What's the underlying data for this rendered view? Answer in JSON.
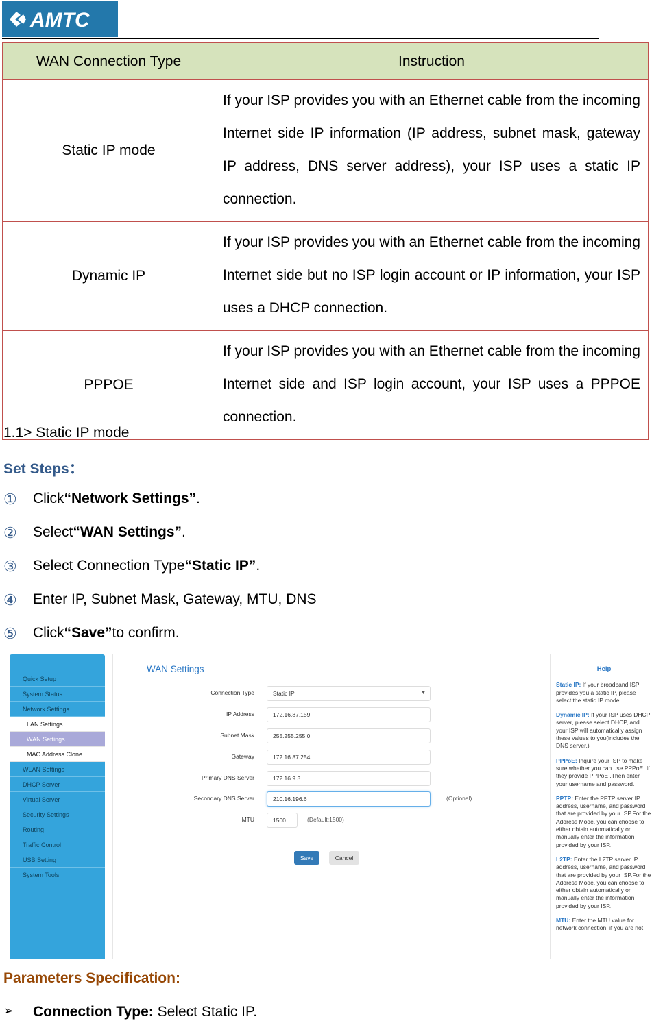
{
  "brand": {
    "logo_text": "AMTC",
    "logo_color": "#2378ab"
  },
  "table": {
    "headers": [
      "WAN Connection Type",
      "Instruction"
    ],
    "rows": [
      {
        "type": "Static IP mode",
        "instruction": "If your ISP provides you with an Ethernet cable from the incoming Internet side IP information (IP address, subnet mask, gateway IP address, DNS server address), your ISP uses a static IP connection."
      },
      {
        "type": "Dynamic IP",
        "instruction": "If your ISP provides you with an Ethernet cable from the incoming Internet side but no ISP login account or IP information, your ISP uses a DHCP connection."
      },
      {
        "type": "PPPOE",
        "instruction": "If your ISP provides you with an Ethernet cable from the incoming Internet side and ISP login account, your ISP uses a PPPOE connection."
      }
    ],
    "header_bg": "#d6e3bc",
    "border_color": "#c0504d"
  },
  "section": {
    "title": "1.1> Static IP mode",
    "set_steps_label": "Set Steps：",
    "steps": [
      {
        "num": "①",
        "pre": "Click ",
        "bold": "“Network Settings”",
        "post": "."
      },
      {
        "num": "②",
        "pre": "Select ",
        "bold": "“WAN Settings”",
        "post": "."
      },
      {
        "num": "③",
        "pre": "Select Connection Type ",
        "bold": "“Static IP”",
        "post": "."
      },
      {
        "num": "④",
        "pre": "Enter IP, Subnet Mask, Gateway, MTU, DNS",
        "bold": "",
        "post": ""
      },
      {
        "num": "⑤",
        "pre": "Click ",
        "bold": "“Save”",
        "post": " to confirm."
      }
    ]
  },
  "screenshot": {
    "sidebar": {
      "items": [
        {
          "label": "Quick Setup"
        },
        {
          "label": "System Status"
        },
        {
          "label": "Network Settings"
        }
      ],
      "subitems": [
        {
          "label": "LAN Settings",
          "active": false
        },
        {
          "label": "WAN Settings",
          "active": true
        },
        {
          "label": "MAC Address Clone",
          "active": false
        }
      ],
      "items_after": [
        {
          "label": "WLAN Settings"
        },
        {
          "label": "DHCP Server"
        },
        {
          "label": "Virtual Server"
        },
        {
          "label": "Security Settings"
        },
        {
          "label": "Routing"
        },
        {
          "label": "Traffic Control"
        },
        {
          "label": "USB Setting"
        },
        {
          "label": "System Tools"
        }
      ]
    },
    "main": {
      "title": "WAN Settings",
      "fields": {
        "connection_type": {
          "label": "Connection Type",
          "value": "Static IP"
        },
        "ip_address": {
          "label": "IP Address",
          "value": "172.16.87.159"
        },
        "subnet_mask": {
          "label": "Subnet Mask",
          "value": "255.255.255.0"
        },
        "gateway": {
          "label": "Gateway",
          "value": "172.16.87.254"
        },
        "primary_dns": {
          "label": "Primary DNS Server",
          "value": "172.16.9.3"
        },
        "secondary_dns": {
          "label": "Secondary DNS Server",
          "value": "210.16.196.6",
          "hint": "(Optional)"
        },
        "mtu": {
          "label": "MTU",
          "value": "1500",
          "hint": "(Default:1500)"
        }
      },
      "save_label": "Save",
      "cancel_label": "Cancel"
    },
    "help": {
      "title": "Help",
      "entries": [
        {
          "term": "Static IP:",
          "text": " If your broadband ISP provides you a static IP, please select the static IP mode."
        },
        {
          "term": "Dynamic IP:",
          "text": " If your ISP uses DHCP server, please select DHCP, and your ISP will automatically assign these values to you(includes the DNS server.)"
        },
        {
          "term": "PPPoE:",
          "text": " Inquire your ISP to make sure whether you can use PPPoE. If they provide PPPoE ,Then enter your username and password."
        },
        {
          "term": "PPTP:",
          "text": " Enter the PPTP server IP address, username, and password that are provided by your ISP.For the Address Mode, you can choose to either obtain automatically or manually enter the information provided by your ISP."
        },
        {
          "term": "L2TP:",
          "text": " Enter the L2TP server IP address, username, and password that are provided by your ISP.For the Address Mode, you can choose to either obtain automatically or manually enter the information provided by your ISP."
        },
        {
          "term": "MTU:",
          "text": " Enter the MTU value for network connection, if you are not"
        }
      ]
    }
  },
  "params": {
    "title": "Parameters Specification:",
    "items": [
      {
        "bullet": "➢",
        "bold": "Connection Type:",
        "text": " Select Static IP."
      }
    ]
  }
}
